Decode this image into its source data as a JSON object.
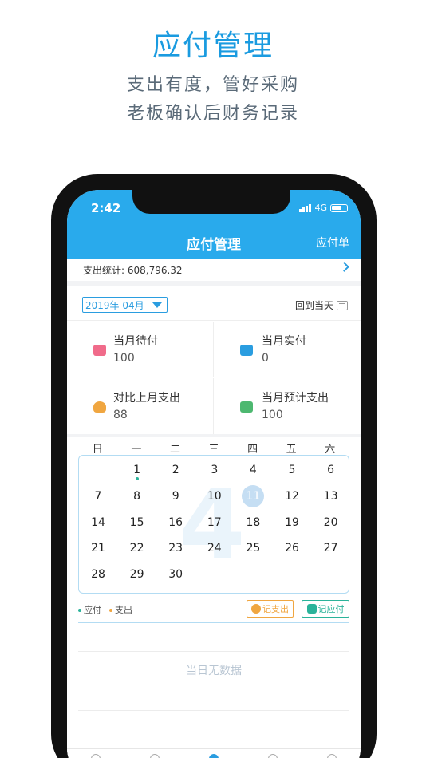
{
  "hero": {
    "title": "应付管理",
    "subtitle_1": "支出有度，管好采购",
    "subtitle_2": "老板确认后财务记录"
  },
  "status_bar": {
    "time": "2:42",
    "network": "4G"
  },
  "nav": {
    "title": "应付管理",
    "action": "应付单"
  },
  "stats": {
    "label": "支出统计: 608,796.32"
  },
  "toolbar": {
    "month": "2019年 04月",
    "today_label": "回到当天"
  },
  "summary": [
    {
      "label": "当月待付",
      "value": "100",
      "icon": "wallet-icon"
    },
    {
      "label": "当月实付",
      "value": "0",
      "icon": "card-icon"
    },
    {
      "label": "对比上月支出",
      "value": "88",
      "icon": "money-bag-icon"
    },
    {
      "label": "当月预计支出",
      "value": "100",
      "icon": "cash-icon"
    }
  ],
  "calendar": {
    "weekdays": [
      "日",
      "一",
      "二",
      "三",
      "四",
      "五",
      "六"
    ],
    "watermark": "4",
    "selected_day": "11",
    "days": [
      "1",
      "2",
      "3",
      "4",
      "5",
      "6",
      "7",
      "8",
      "9",
      "10",
      "11",
      "12",
      "13",
      "14",
      "15",
      "16",
      "17",
      "18",
      "19",
      "20",
      "21",
      "22",
      "23",
      "24",
      "25",
      "26",
      "27",
      "28",
      "29",
      "30"
    ]
  },
  "legend": {
    "payable": "应付",
    "expense": "支出"
  },
  "buttons": {
    "record_expense": "记支出",
    "record_payable": "记应付"
  },
  "empty_text": "当日无数据",
  "colors": {
    "primary": "#29aaec",
    "payable_dot": "#2ab39a",
    "expense_dot": "#f0a640"
  }
}
